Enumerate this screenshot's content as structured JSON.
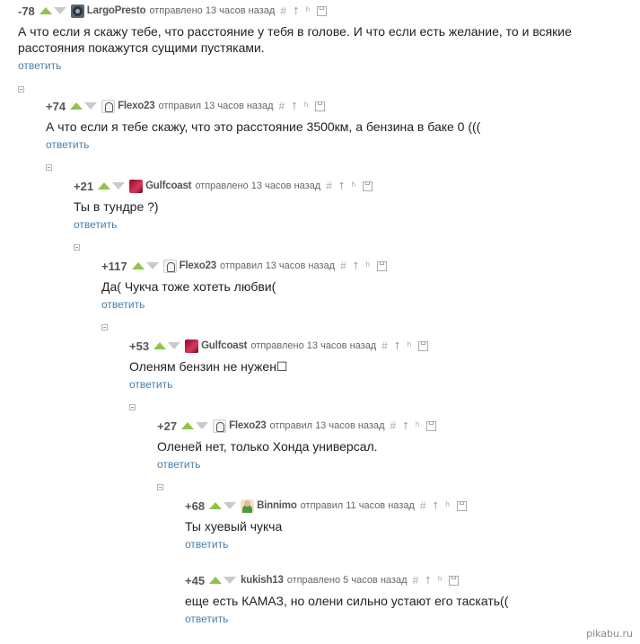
{
  "icons": {
    "reply_icon": "hash-icon",
    "up_icon": "arrow-up-icon",
    "branch_icon": "branch-icon",
    "save_icon": "save-icon"
  },
  "colors": {
    "up_arrow": "#8fc44c",
    "down_arrow": "#c9c9c9",
    "link": "#4a7da8"
  },
  "tool_glyphs": {
    "hash": "#",
    "up": "⭡",
    "branch": "ʰ"
  },
  "comments": [
    {
      "rating": "-78",
      "user": "LargoPresto",
      "posted": "отправлено 13 часов назад",
      "text": "А что если я скажу тебе, что расстояние у тебя в голове. И что если есть желание, то и всякие расстояния покажутся сущими пустяками.",
      "reply": "ответить",
      "avatar": "dark"
    },
    {
      "rating": "+74",
      "user": "Flexo23",
      "posted": "отправил 13 часов назад",
      "text": "А что если я тебе скажу, что это расстояние 3500км, а бензина в баке 0 (((",
      "reply": "ответить",
      "avatar": "cartoon"
    },
    {
      "rating": "+21",
      "user": "Gulfcoast",
      "posted": "отправлено 13 часов назад",
      "text": "Ты в тундре ?)",
      "reply": "ответить",
      "avatar": "red"
    },
    {
      "rating": "+117",
      "user": "Flexo23",
      "posted": "отправил 13 часов назад",
      "text": "Да( Чукча тоже хотеть любви(",
      "reply": "ответить",
      "avatar": "cartoon"
    },
    {
      "rating": "+53",
      "user": "Gulfcoast",
      "posted": "отправлено 13 часов назад",
      "text": "Оленям бензин не нужен☐",
      "reply": "ответить",
      "avatar": "red"
    },
    {
      "rating": "+27",
      "user": "Flexo23",
      "posted": "отправил 13 часов назад",
      "text": "Оленей нет, только Хонда универсал.",
      "reply": "ответить",
      "avatar": "cartoon"
    },
    {
      "rating": "+68",
      "user": "Binnimo",
      "posted": "отправил 11 часов назад",
      "text": "Ты хуевый чукча",
      "reply": "ответить",
      "avatar": "man"
    },
    {
      "rating": "+45",
      "user": "kukish13",
      "posted": "отправлено 5 часов назад",
      "text": "еще есть КАМАЗ, но олени сильно устают его таскать((",
      "reply": "ответить",
      "avatar": "none"
    }
  ],
  "watermark": "pikabu.ru"
}
